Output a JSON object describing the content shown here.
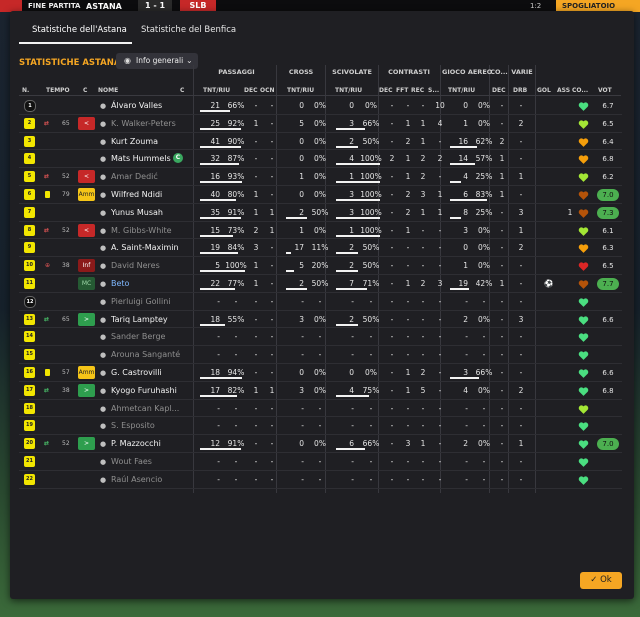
{
  "topbar": {
    "status": "FINE PARTITA",
    "home": "ASTANA",
    "score": "1 - 1",
    "away": "SLB",
    "clock": "1:2",
    "right": "SPOGLIATOIO"
  },
  "tabs": [
    "Statistiche dell'Astana",
    "Statistiche del Benfica"
  ],
  "section_title": "STATISTICHE ASTANA",
  "dropdown": {
    "label": "Info generali"
  },
  "groups": [
    "PASSAGGI",
    "CROSS",
    "SCIVOLATE",
    "CONTRASTI",
    "GIOCO AEREO",
    "CO...",
    "VARIE"
  ],
  "headers": {
    "n": "N.",
    "tempo": "TEMPO",
    "c": "C",
    "nome": "NOME",
    "c2": "C",
    "pass": "TNT/RIU",
    "dec": "DEC",
    "ocn": "OCN",
    "cross": "TNT/RIU",
    "sciv": "TNT/RIU",
    "cdec": "DEC",
    "fft": "FFT",
    "rec": "REC",
    "s": "S...",
    "aereo": "TNT/RIU",
    "codec": "DEC",
    "drb": "DRB",
    "gol": "GOL",
    "ass": "ASS",
    "co": "CO...",
    "vot": "VOT"
  },
  "ok_label": "Ok",
  "colors": {
    "accent": "#f5a623",
    "shirt": "#f2e600",
    "green": "#4caf50",
    "red": "#c62828"
  },
  "players": [
    {
      "n": "1",
      "gk": true,
      "ev": "",
      "min": "",
      "btn": "",
      "btn_label": "",
      "name": "Álvaro Valles",
      "dim": false,
      "cap": false,
      "p_t": "21",
      "p_r": "66%",
      "p_f": 0.66,
      "dec": "-",
      "ocn": "-",
      "cr_t": "0",
      "cr_r": "0%",
      "cr_f": 0,
      "sc_t": "0",
      "sc_r": "0%",
      "sc_f": 0,
      "cdec": "-",
      "fft": "-",
      "rec": "-",
      "s": "10",
      "ae_t": "0",
      "ae_r": "0%",
      "ae_f": 0,
      "codec": "-",
      "drb": "-",
      "gol": "",
      "ass": "",
      "heart": "#4ade80",
      "vote": "6.7",
      "vg": false
    },
    {
      "n": "2",
      "gk": false,
      "ev": "sub-out",
      "min": "65",
      "btn": "out",
      "btn_label": "<",
      "name": "K. Walker-Peters",
      "dim": true,
      "cap": false,
      "p_t": "25",
      "p_r": "92%",
      "p_f": 0.92,
      "dec": "1",
      "ocn": "-",
      "cr_t": "5",
      "cr_r": "0%",
      "cr_f": 0,
      "sc_t": "3",
      "sc_r": "66%",
      "sc_f": 0.66,
      "cdec": "-",
      "fft": "1",
      "rec": "1",
      "s": "4",
      "ae_t": "1",
      "ae_r": "0%",
      "ae_f": 0,
      "codec": "-",
      "drb": "2",
      "gol": "",
      "ass": "",
      "heart": "#a3e635",
      "vote": "6.5",
      "vg": false
    },
    {
      "n": "3",
      "gk": false,
      "ev": "",
      "min": "",
      "btn": "",
      "btn_label": "",
      "name": "Kurt Zouma",
      "dim": false,
      "cap": false,
      "p_t": "41",
      "p_r": "90%",
      "p_f": 0.9,
      "dec": "-",
      "ocn": "-",
      "cr_t": "0",
      "cr_r": "0%",
      "cr_f": 0,
      "sc_t": "2",
      "sc_r": "50%",
      "sc_f": 0.5,
      "cdec": "-",
      "fft": "2",
      "rec": "1",
      "s": "-",
      "ae_t": "16",
      "ae_r": "62%",
      "ae_f": 0.62,
      "codec": "2",
      "drb": "-",
      "gol": "",
      "ass": "",
      "heart": "#f59e0b",
      "vote": "6.4",
      "vg": false
    },
    {
      "n": "4",
      "gk": false,
      "ev": "",
      "min": "",
      "btn": "",
      "btn_label": "",
      "name": "Mats Hummels",
      "dim": false,
      "cap": true,
      "p_t": "32",
      "p_r": "87%",
      "p_f": 0.87,
      "dec": "-",
      "ocn": "-",
      "cr_t": "0",
      "cr_r": "0%",
      "cr_f": 0,
      "sc_t": "4",
      "sc_r": "100%",
      "sc_f": 1,
      "cdec": "2",
      "fft": "1",
      "rec": "2",
      "s": "2",
      "ae_t": "14",
      "ae_r": "57%",
      "ae_f": 0.57,
      "codec": "1",
      "drb": "-",
      "gol": "",
      "ass": "",
      "heart": "#f59e0b",
      "vote": "6.8",
      "vg": false
    },
    {
      "n": "5",
      "gk": false,
      "ev": "sub-out",
      "min": "52",
      "btn": "out",
      "btn_label": "<",
      "name": "Amar Dedić",
      "dim": true,
      "cap": false,
      "p_t": "16",
      "p_r": "93%",
      "p_f": 0.93,
      "dec": "-",
      "ocn": "-",
      "cr_t": "1",
      "cr_r": "0%",
      "cr_f": 0,
      "sc_t": "1",
      "sc_r": "100%",
      "sc_f": 1,
      "cdec": "-",
      "fft": "1",
      "rec": "2",
      "s": "-",
      "ae_t": "4",
      "ae_r": "25%",
      "ae_f": 0.25,
      "codec": "1",
      "drb": "1",
      "gol": "",
      "ass": "",
      "heart": "#a3e635",
      "vote": "6.2",
      "vg": false
    },
    {
      "n": "6",
      "gk": false,
      "ev": "yellow",
      "min": "79",
      "btn": "amm",
      "btn_label": "Amm",
      "name": "Wilfred Ndidi",
      "dim": false,
      "cap": false,
      "p_t": "40",
      "p_r": "80%",
      "p_f": 0.8,
      "dec": "1",
      "ocn": "-",
      "cr_t": "0",
      "cr_r": "0%",
      "cr_f": 0,
      "sc_t": "3",
      "sc_r": "100%",
      "sc_f": 1,
      "cdec": "-",
      "fft": "2",
      "rec": "3",
      "s": "1",
      "ae_t": "6",
      "ae_r": "83%",
      "ae_f": 0.83,
      "codec": "1",
      "drb": "-",
      "gol": "",
      "ass": "",
      "heart": "#b45309",
      "vote": "7.0",
      "vg": true
    },
    {
      "n": "7",
      "gk": false,
      "ev": "",
      "min": "",
      "btn": "",
      "btn_label": "",
      "name": "Yunus Musah",
      "dim": false,
      "cap": false,
      "p_t": "35",
      "p_r": "91%",
      "p_f": 0.91,
      "dec": "1",
      "ocn": "1",
      "cr_t": "2",
      "cr_r": "50%",
      "cr_f": 0.5,
      "sc_t": "3",
      "sc_r": "100%",
      "sc_f": 1,
      "cdec": "-",
      "fft": "2",
      "rec": "1",
      "s": "1",
      "ae_t": "8",
      "ae_r": "25%",
      "ae_f": 0.25,
      "codec": "-",
      "drb": "3",
      "gol": "",
      "ass": "1",
      "heart": "#b45309",
      "vote": "7.3",
      "vg": true
    },
    {
      "n": "8",
      "gk": false,
      "ev": "sub-out",
      "min": "52",
      "btn": "out",
      "btn_label": "<",
      "name": "M. Gibbs-White",
      "dim": true,
      "cap": false,
      "p_t": "15",
      "p_r": "73%",
      "p_f": 0.73,
      "dec": "2",
      "ocn": "1",
      "cr_t": "1",
      "cr_r": "0%",
      "cr_f": 0,
      "sc_t": "1",
      "sc_r": "100%",
      "sc_f": 1,
      "cdec": "-",
      "fft": "1",
      "rec": "-",
      "s": "-",
      "ae_t": "3",
      "ae_r": "0%",
      "ae_f": 0,
      "codec": "-",
      "drb": "1",
      "gol": "",
      "ass": "",
      "heart": "#a3e635",
      "vote": "6.1",
      "vg": false
    },
    {
      "n": "9",
      "gk": false,
      "ev": "",
      "min": "",
      "btn": "",
      "btn_label": "",
      "name": "A. Saint-Maximin",
      "dim": false,
      "cap": false,
      "p_t": "19",
      "p_r": "84%",
      "p_f": 0.84,
      "dec": "3",
      "ocn": "-",
      "cr_t": "17",
      "cr_r": "11%",
      "cr_f": 0.11,
      "sc_t": "2",
      "sc_r": "50%",
      "sc_f": 0.5,
      "cdec": "-",
      "fft": "-",
      "rec": "-",
      "s": "-",
      "ae_t": "0",
      "ae_r": "0%",
      "ae_f": 0,
      "codec": "-",
      "drb": "2",
      "gol": "",
      "ass": "",
      "heart": "#f59e0b",
      "vote": "6.3",
      "vg": false
    },
    {
      "n": "10",
      "gk": false,
      "ev": "injury",
      "min": "38",
      "btn": "inf",
      "btn_label": "Inf",
      "name": "David Neres",
      "dim": true,
      "cap": false,
      "p_t": "5",
      "p_r": "100%",
      "p_f": 1,
      "dec": "1",
      "ocn": "-",
      "cr_t": "5",
      "cr_r": "20%",
      "cr_f": 0.2,
      "sc_t": "2",
      "sc_r": "50%",
      "sc_f": 0.5,
      "cdec": "-",
      "fft": "-",
      "rec": "-",
      "s": "-",
      "ae_t": "1",
      "ae_r": "0%",
      "ae_f": 0,
      "codec": "-",
      "drb": "-",
      "gol": "",
      "ass": "",
      "heart": "#dc2626",
      "vote": "6.5",
      "vg": false
    },
    {
      "n": "11",
      "gk": false,
      "ev": "",
      "min": "",
      "btn": "mc",
      "btn_label": "MC",
      "name": "Beto",
      "dim": false,
      "cap": false,
      "hl": true,
      "p_t": "22",
      "p_r": "77%",
      "p_f": 0.77,
      "dec": "1",
      "ocn": "-",
      "cr_t": "2",
      "cr_r": "50%",
      "cr_f": 0.5,
      "sc_t": "7",
      "sc_r": "71%",
      "sc_f": 0.71,
      "cdec": "-",
      "fft": "1",
      "rec": "2",
      "s": "3",
      "ae_t": "19",
      "ae_r": "42%",
      "ae_f": 0.42,
      "codec": "1",
      "drb": "-",
      "gol": "⚽",
      "ass": "",
      "heart": "#b45309",
      "vote": "7.7",
      "vg": true
    },
    {
      "n": "12",
      "gk": true,
      "ev": "",
      "min": "",
      "btn": "",
      "btn_label": "",
      "name": "Pierluigi Gollini",
      "dim": true,
      "cap": false,
      "p_t": "-",
      "p_r": "-",
      "p_f": -1,
      "dec": "-",
      "ocn": "-",
      "cr_t": "-",
      "cr_r": "-",
      "cr_f": -1,
      "sc_t": "-",
      "sc_r": "-",
      "sc_f": -1,
      "cdec": "-",
      "fft": "-",
      "rec": "-",
      "s": "-",
      "ae_t": "-",
      "ae_r": "-",
      "ae_f": -1,
      "codec": "-",
      "drb": "-",
      "gol": "",
      "ass": "",
      "heart": "#4ade80",
      "vote": "",
      "vg": false
    },
    {
      "n": "13",
      "gk": false,
      "ev": "sub-in",
      "min": "65",
      "btn": "in",
      "btn_label": ">",
      "name": "Tariq Lamptey",
      "dim": false,
      "cap": false,
      "p_t": "18",
      "p_r": "55%",
      "p_f": 0.55,
      "dec": "-",
      "ocn": "-",
      "cr_t": "3",
      "cr_r": "0%",
      "cr_f": 0,
      "sc_t": "2",
      "sc_r": "50%",
      "sc_f": 0.5,
      "cdec": "-",
      "fft": "-",
      "rec": "-",
      "s": "-",
      "ae_t": "2",
      "ae_r": "0%",
      "ae_f": 0,
      "codec": "-",
      "drb": "3",
      "gol": "",
      "ass": "",
      "heart": "#4ade80",
      "vote": "6.6",
      "vg": false
    },
    {
      "n": "14",
      "gk": false,
      "ev": "",
      "min": "",
      "btn": "",
      "btn_label": "",
      "name": "Sander Berge",
      "dim": true,
      "cap": false,
      "p_t": "-",
      "p_r": "-",
      "p_f": -1,
      "dec": "-",
      "ocn": "-",
      "cr_t": "-",
      "cr_r": "-",
      "cr_f": -1,
      "sc_t": "-",
      "sc_r": "-",
      "sc_f": -1,
      "cdec": "-",
      "fft": "-",
      "rec": "-",
      "s": "-",
      "ae_t": "-",
      "ae_r": "-",
      "ae_f": -1,
      "codec": "-",
      "drb": "-",
      "gol": "",
      "ass": "",
      "heart": "#4ade80",
      "vote": "",
      "vg": false
    },
    {
      "n": "15",
      "gk": false,
      "ev": "",
      "min": "",
      "btn": "",
      "btn_label": "",
      "name": "Arouna Sanganté",
      "dim": true,
      "cap": false,
      "p_t": "-",
      "p_r": "-",
      "p_f": -1,
      "dec": "-",
      "ocn": "-",
      "cr_t": "-",
      "cr_r": "-",
      "cr_f": -1,
      "sc_t": "-",
      "sc_r": "-",
      "sc_f": -1,
      "cdec": "-",
      "fft": "-",
      "rec": "-",
      "s": "-",
      "ae_t": "-",
      "ae_r": "-",
      "ae_f": -1,
      "codec": "-",
      "drb": "-",
      "gol": "",
      "ass": "",
      "heart": "#4ade80",
      "vote": "",
      "vg": false
    },
    {
      "n": "16",
      "gk": false,
      "ev": "yellow",
      "min": "57",
      "btn": "amm",
      "btn_label": "Amm",
      "name": "G. Castrovilli",
      "dim": false,
      "cap": false,
      "p_t": "18",
      "p_r": "94%",
      "p_f": 0.94,
      "dec": "-",
      "ocn": "-",
      "cr_t": "0",
      "cr_r": "0%",
      "cr_f": 0,
      "sc_t": "0",
      "sc_r": "0%",
      "sc_f": 0,
      "cdec": "-",
      "fft": "1",
      "rec": "2",
      "s": "-",
      "ae_t": "3",
      "ae_r": "66%",
      "ae_f": 0.66,
      "codec": "-",
      "drb": "-",
      "gol": "",
      "ass": "",
      "heart": "#4ade80",
      "vote": "6.6",
      "vg": false
    },
    {
      "n": "17",
      "gk": false,
      "ev": "sub-in",
      "min": "38",
      "btn": "in",
      "btn_label": ">",
      "name": "Kyogo Furuhashi",
      "dim": false,
      "cap": false,
      "p_t": "17",
      "p_r": "82%",
      "p_f": 0.82,
      "dec": "1",
      "ocn": "1",
      "cr_t": "3",
      "cr_r": "0%",
      "cr_f": 0,
      "sc_t": "4",
      "sc_r": "75%",
      "sc_f": 0.75,
      "cdec": "-",
      "fft": "1",
      "rec": "5",
      "s": "-",
      "ae_t": "4",
      "ae_r": "0%",
      "ae_f": 0,
      "codec": "-",
      "drb": "2",
      "gol": "",
      "ass": "",
      "heart": "#4ade80",
      "vote": "6.8",
      "vg": false
    },
    {
      "n": "18",
      "gk": false,
      "ev": "",
      "min": "",
      "btn": "",
      "btn_label": "",
      "name": "Ahmetcan Kapl...",
      "dim": true,
      "cap": false,
      "p_t": "-",
      "p_r": "-",
      "p_f": -1,
      "dec": "-",
      "ocn": "-",
      "cr_t": "-",
      "cr_r": "-",
      "cr_f": -1,
      "sc_t": "-",
      "sc_r": "-",
      "sc_f": -1,
      "cdec": "-",
      "fft": "-",
      "rec": "-",
      "s": "-",
      "ae_t": "-",
      "ae_r": "-",
      "ae_f": -1,
      "codec": "-",
      "drb": "-",
      "gol": "",
      "ass": "",
      "heart": "#a3e635",
      "vote": "",
      "vg": false
    },
    {
      "n": "19",
      "gk": false,
      "ev": "",
      "min": "",
      "btn": "",
      "btn_label": "",
      "name": "S. Esposito",
      "dim": true,
      "cap": false,
      "p_t": "-",
      "p_r": "-",
      "p_f": -1,
      "dec": "-",
      "ocn": "-",
      "cr_t": "-",
      "cr_r": "-",
      "cr_f": -1,
      "sc_t": "-",
      "sc_r": "-",
      "sc_f": -1,
      "cdec": "-",
      "fft": "-",
      "rec": "-",
      "s": "-",
      "ae_t": "-",
      "ae_r": "-",
      "ae_f": -1,
      "codec": "-",
      "drb": "-",
      "gol": "",
      "ass": "",
      "heart": "#4ade80",
      "vote": "",
      "vg": false
    },
    {
      "n": "20",
      "gk": false,
      "ev": "sub-in",
      "min": "52",
      "btn": "in",
      "btn_label": ">",
      "name": "P. Mazzocchi",
      "dim": false,
      "cap": false,
      "p_t": "12",
      "p_r": "91%",
      "p_f": 0.91,
      "dec": "-",
      "ocn": "-",
      "cr_t": "0",
      "cr_r": "0%",
      "cr_f": 0,
      "sc_t": "6",
      "sc_r": "66%",
      "sc_f": 0.66,
      "cdec": "-",
      "fft": "3",
      "rec": "1",
      "s": "-",
      "ae_t": "2",
      "ae_r": "0%",
      "ae_f": 0,
      "codec": "-",
      "drb": "1",
      "gol": "",
      "ass": "",
      "heart": "#4ade80",
      "vote": "7.0",
      "vg": true
    },
    {
      "n": "21",
      "gk": false,
      "ev": "",
      "min": "",
      "btn": "",
      "btn_label": "",
      "name": "Wout Faes",
      "dim": true,
      "cap": false,
      "p_t": "-",
      "p_r": "-",
      "p_f": -1,
      "dec": "-",
      "ocn": "-",
      "cr_t": "-",
      "cr_r": "-",
      "cr_f": -1,
      "sc_t": "-",
      "sc_r": "-",
      "sc_f": -1,
      "cdec": "-",
      "fft": "-",
      "rec": "-",
      "s": "-",
      "ae_t": "-",
      "ae_r": "-",
      "ae_f": -1,
      "codec": "-",
      "drb": "-",
      "gol": "",
      "ass": "",
      "heart": "#4ade80",
      "vote": "",
      "vg": false
    },
    {
      "n": "22",
      "gk": false,
      "ev": "",
      "min": "",
      "btn": "",
      "btn_label": "",
      "name": "Raúl Asencio",
      "dim": true,
      "cap": false,
      "p_t": "-",
      "p_r": "-",
      "p_f": -1,
      "dec": "-",
      "ocn": "-",
      "cr_t": "-",
      "cr_r": "-",
      "cr_f": -1,
      "sc_t": "-",
      "sc_r": "-",
      "sc_f": -1,
      "cdec": "-",
      "fft": "-",
      "rec": "-",
      "s": "-",
      "ae_t": "-",
      "ae_r": "-",
      "ae_f": -1,
      "codec": "-",
      "drb": "-",
      "gol": "",
      "ass": "",
      "heart": "#4ade80",
      "vote": "",
      "vg": false
    }
  ]
}
